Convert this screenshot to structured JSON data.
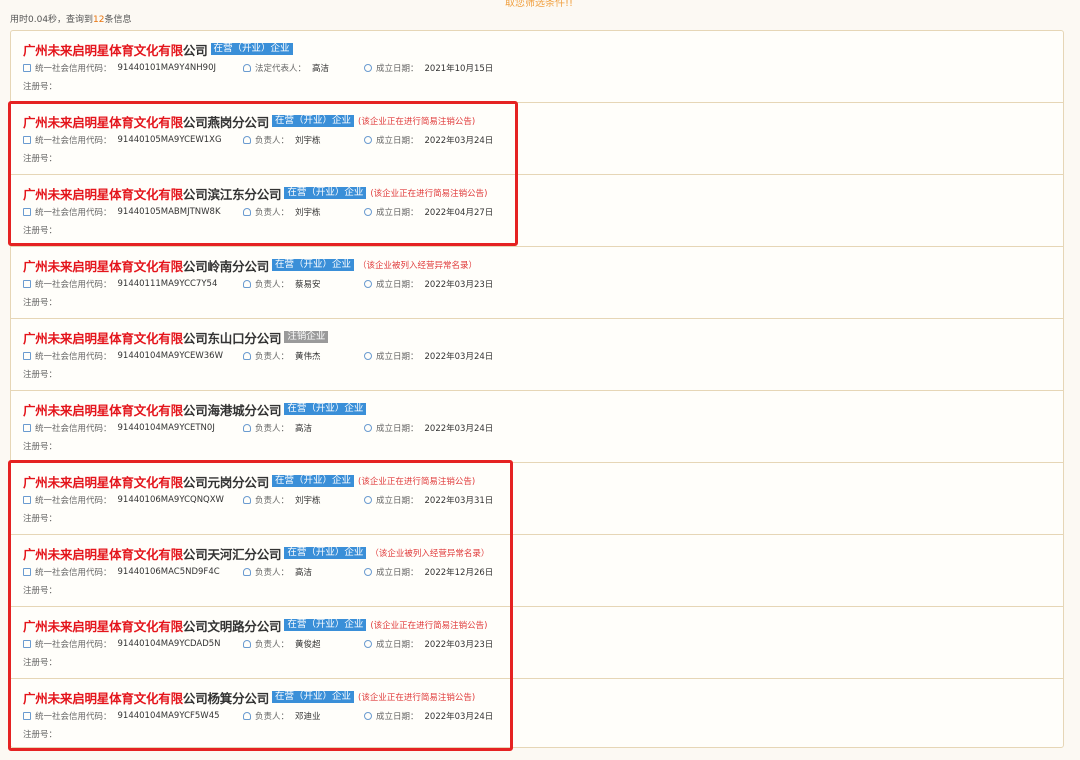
{
  "top_hint": "取您筛选条件!!",
  "summary": {
    "prefix": "用时0.04秒，查询到",
    "count": "12",
    "suffix": "条信息"
  },
  "labels": {
    "credit_code": "统一社会信用代码：",
    "legal_rep": "法定代表人：",
    "person_in_charge": "负责人：",
    "founded": "成立日期：",
    "reg_no": "注册号："
  },
  "colors": {
    "highlight": "#e4141b",
    "badge_active": "#3a8fd8",
    "badge_cancelled": "#9a9a9a",
    "outline": "#e52222"
  },
  "companies": [
    {
      "name_highlight": "广州未来启明星体育文化有限",
      "name_rest": "公司",
      "status": "在营（开业）企业",
      "notice": "",
      "code": "91440101MA9Y4NH90J",
      "person_label": "法定代表人：",
      "person": "高洁",
      "date": "2021年10月15日"
    },
    {
      "name_highlight": "广州未来启明星体育文化有限",
      "name_rest": "公司燕岗分公司",
      "status": "在营（开业）企业",
      "notice": "(该企业正在进行简易注销公告)",
      "code": "91440105MA9YCEW1XG",
      "person_label": "负责人：",
      "person": "刘宇栋",
      "date": "2022年03月24日"
    },
    {
      "name_highlight": "广州未来启明星体育文化有限",
      "name_rest": "公司滨江东分公司",
      "status": "在营（开业）企业",
      "notice": "(该企业正在进行简易注销公告)",
      "code": "91440105MABMJTNW8K",
      "person_label": "负责人：",
      "person": "刘宇栋",
      "date": "2022年04月27日"
    },
    {
      "name_highlight": "广州未来启明星体育文化有限",
      "name_rest": "公司岭南分公司",
      "status": "在营（开业）企业",
      "notice": "（该企业被列入经营异常名录）",
      "code": "91440111MA9YCC7Y54",
      "person_label": "负责人：",
      "person": "蔡易安",
      "date": "2022年03月23日"
    },
    {
      "name_highlight": "广州未来启明星体育文化有限",
      "name_rest": "公司东山口分公司",
      "status": "注销企业",
      "notice": "",
      "code": "91440104MA9YCEW36W",
      "person_label": "负责人：",
      "person": "黄伟杰",
      "date": "2022年03月24日"
    },
    {
      "name_highlight": "广州未来启明星体育文化有限",
      "name_rest": "公司海港城分公司",
      "status": "在营（开业）企业",
      "notice": "",
      "code": "91440104MA9YCETN0J",
      "person_label": "负责人：",
      "person": "高洁",
      "date": "2022年03月24日"
    },
    {
      "name_highlight": "广州未来启明星体育文化有限",
      "name_rest": "公司元岗分公司",
      "status": "在营（开业）企业",
      "notice": "(该企业正在进行简易注销公告)",
      "code": "91440106MA9YCQNQXW",
      "person_label": "负责人：",
      "person": "刘宇栋",
      "date": "2022年03月31日"
    },
    {
      "name_highlight": "广州未来启明星体育文化有限",
      "name_rest": "公司天河汇分公司",
      "status": "在营（开业）企业",
      "notice": "（该企业被列入经营异常名录）",
      "code": "91440106MAC5ND9F4C",
      "person_label": "负责人：",
      "person": "高洁",
      "date": "2022年12月26日"
    },
    {
      "name_highlight": "广州未来启明星体育文化有限",
      "name_rest": "公司文明路分公司",
      "status": "在营（开业）企业",
      "notice": "(该企业正在进行简易注销公告)",
      "code": "91440104MA9YCDAD5N",
      "person_label": "负责人：",
      "person": "黄俊超",
      "date": "2022年03月23日"
    },
    {
      "name_highlight": "广州未来启明星体育文化有限",
      "name_rest": "公司杨箕分公司",
      "status": "在营（开业）企业",
      "notice": "(该企业正在进行简易注销公告)",
      "code": "91440104MA9YCF5W45",
      "person_label": "负责人：",
      "person": "邓迪业",
      "date": "2022年03月24日"
    }
  ]
}
